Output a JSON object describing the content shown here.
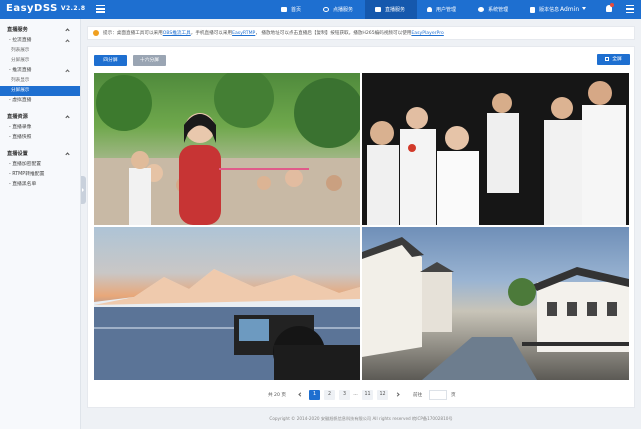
{
  "app": {
    "name": "EasyDSS",
    "version": "V2.2.8"
  },
  "nav": [
    {
      "label": "首页",
      "icon": "home-icon",
      "active": false
    },
    {
      "label": "点播服务",
      "icon": "video-icon",
      "active": false
    },
    {
      "label": "直播服务",
      "icon": "live-icon",
      "active": true
    },
    {
      "label": "用户管理",
      "icon": "user-icon",
      "active": false
    },
    {
      "label": "系统管理",
      "icon": "gear-icon",
      "active": false
    },
    {
      "label": "版本信息",
      "icon": "info-icon",
      "active": false
    }
  ],
  "user": {
    "name": "Admin"
  },
  "sidebar": {
    "groups": [
      {
        "label": "直播服务",
        "children": [
          {
            "label": "- 拉流直播",
            "leaves": [
              "列表展示",
              "分屏展示"
            ]
          },
          {
            "label": "- 推流直播",
            "leaves": [
              "列表显示",
              "分屏展示"
            ]
          },
          {
            "label": "- 虚拟直播",
            "leaves": []
          }
        ]
      },
      {
        "label": "直播资源",
        "children": [
          {
            "label": "- 直播录像",
            "leaves": []
          },
          {
            "label": "- 直播快照",
            "leaves": []
          }
        ]
      },
      {
        "label": "直播设置",
        "children": [
          {
            "label": "- 直播加密配置",
            "leaves": []
          },
          {
            "label": "- RTMP转推配置",
            "leaves": []
          },
          {
            "label": "- 直播黑名单",
            "leaves": []
          }
        ]
      }
    ]
  },
  "notice": {
    "pre": "提示：桌面直播工具可以采用",
    "link1": "OBS推流工具",
    "mid1": "，手机直播可以采用",
    "link2": "EasyRTMP",
    "mid2": "，  播放地址可以点击直播后【复制】按钮获取。播放H265编码视频可以使用",
    "link3": "EasyPlayerPro"
  },
  "toolbar": {
    "four": "四分屏",
    "sixteen": "十六分屏",
    "fullscreen": "全屏"
  },
  "pager": {
    "total": "共 20 页",
    "pages": [
      "1",
      "2",
      "3",
      "...",
      "11",
      "12"
    ],
    "active": "1",
    "goto": "前往",
    "unit": "页"
  },
  "footer": "Copyright © 2014-2020 安徽旭帆信息科技有限公司 All rights reserved 皖ICP备17002810号"
}
